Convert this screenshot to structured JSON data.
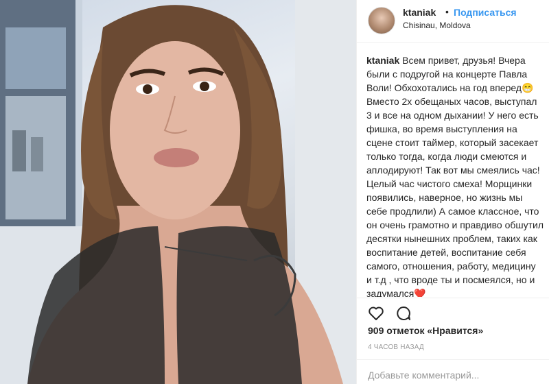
{
  "post": {
    "username": "ktaniak",
    "dot": "•",
    "follow_label": "Подписаться",
    "location": "Chisinau, Moldova",
    "caption_user": "ktaniak",
    "caption_text": " Всем привет, друзья! Вчера были с подругой на концерте Павла Воли! Обхохотались на год вперед😁Вместо 2х обещаных часов, выступал 3 и все на одном дыхании! У него есть фишка, во время выступления на сцене стоит таймер, который засекает только тогда, когда люди смеются и аплодируют! Так вот мы смеялись час! Целый час чистого смеха! Морщинки появились, наверное, но жизнь мы себе продлили) А самое классное, что он очень грамотно и правдиво обшутил десятки нынешних проблем, таких как воспитание детей, воспитание себя самого, отношения, работу, медицину и т.д , что вроде ты и посмеялся, но и задумался❤️\nСегодня вот жду своих девчонок на пижамную вечеринку, и далее вся неделя забита встречами!🙈 А вы обычно планируете свои дни или как",
    "likes": "909 отметок «Нравится»",
    "time": "4 ЧАСОВ НАЗАД",
    "comment_placeholder": "Добавьте комментарий..."
  },
  "icons": {
    "avatar": "profile-avatar",
    "like": "heart-icon",
    "comment": "comment-icon",
    "photo": "selfie-photo"
  }
}
